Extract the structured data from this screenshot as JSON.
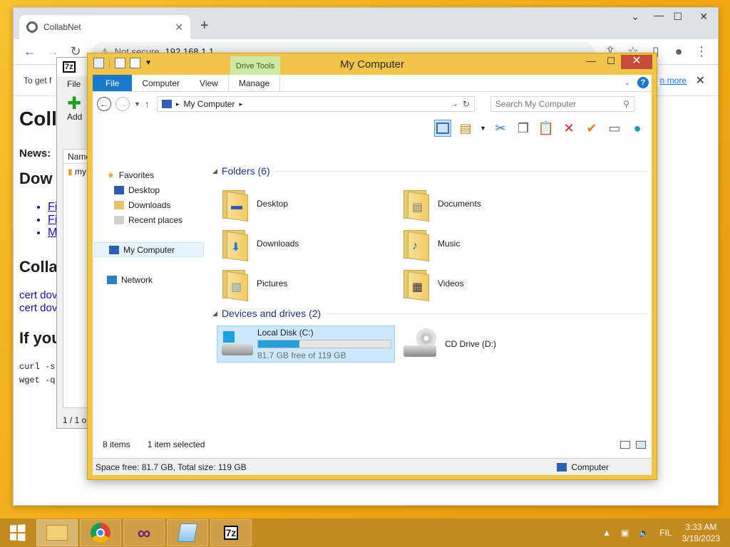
{
  "chrome": {
    "tab_title": "CollabNet",
    "new_tab": "+",
    "not_secure": "Not secure",
    "url": "192.168.1.1",
    "infobar_text": "To get f",
    "infobar_link": "n more",
    "page": {
      "h1": "Coll",
      "news": "News:",
      "h2_download": "Dow",
      "links": [
        "Fi",
        "Fi",
        "M"
      ],
      "h2_colla": "Colla",
      "cert_links": [
        "cert dov",
        "cert dov"
      ],
      "h2_if": "If you",
      "code": [
        "curl -s",
        "wget -q("
      ]
    }
  },
  "sevenzip": {
    "logo": "7z",
    "menu_file": "File",
    "add_label": "Add",
    "list_header": "Name",
    "list_item": "my",
    "status": "1 / 1 o"
  },
  "explorer": {
    "title": "My Computer",
    "drive_tools": "Drive Tools",
    "ribbon_tabs": [
      "File",
      "Computer",
      "View",
      "Manage"
    ],
    "address": "My Computer",
    "search_placeholder": "Search My Computer",
    "nav": {
      "favorites": "Favorites",
      "favorites_items": [
        "Desktop",
        "Downloads",
        "Recent places"
      ],
      "my_computer": "My Computer",
      "network": "Network"
    },
    "folders_header": "Folders (6)",
    "folders": [
      "Desktop",
      "Documents",
      "Downloads",
      "Music",
      "Pictures",
      "Videos"
    ],
    "devices_header": "Devices and drives (2)",
    "local_disk": {
      "name": "Local Disk (C:)",
      "free_text": "81.7 GB free of 119 GB",
      "used_fraction": 0.31
    },
    "cd_drive": "CD Drive (D:)",
    "item_count": "8 items",
    "selected_count": "1 item selected",
    "details_text": "Space free: 81.7 GB, Total size: 119 GB",
    "details_right": "Computer"
  },
  "taskbar": {
    "sevenzip_label": "7z",
    "lang": "FIL",
    "time": "3:33 AM",
    "date": "3/18/2023"
  },
  "colors": {
    "accent": "#1979ca",
    "desktop": "#f3b21c",
    "explorer_frame": "#f0c54a",
    "disk_fill": "#26a0da"
  }
}
